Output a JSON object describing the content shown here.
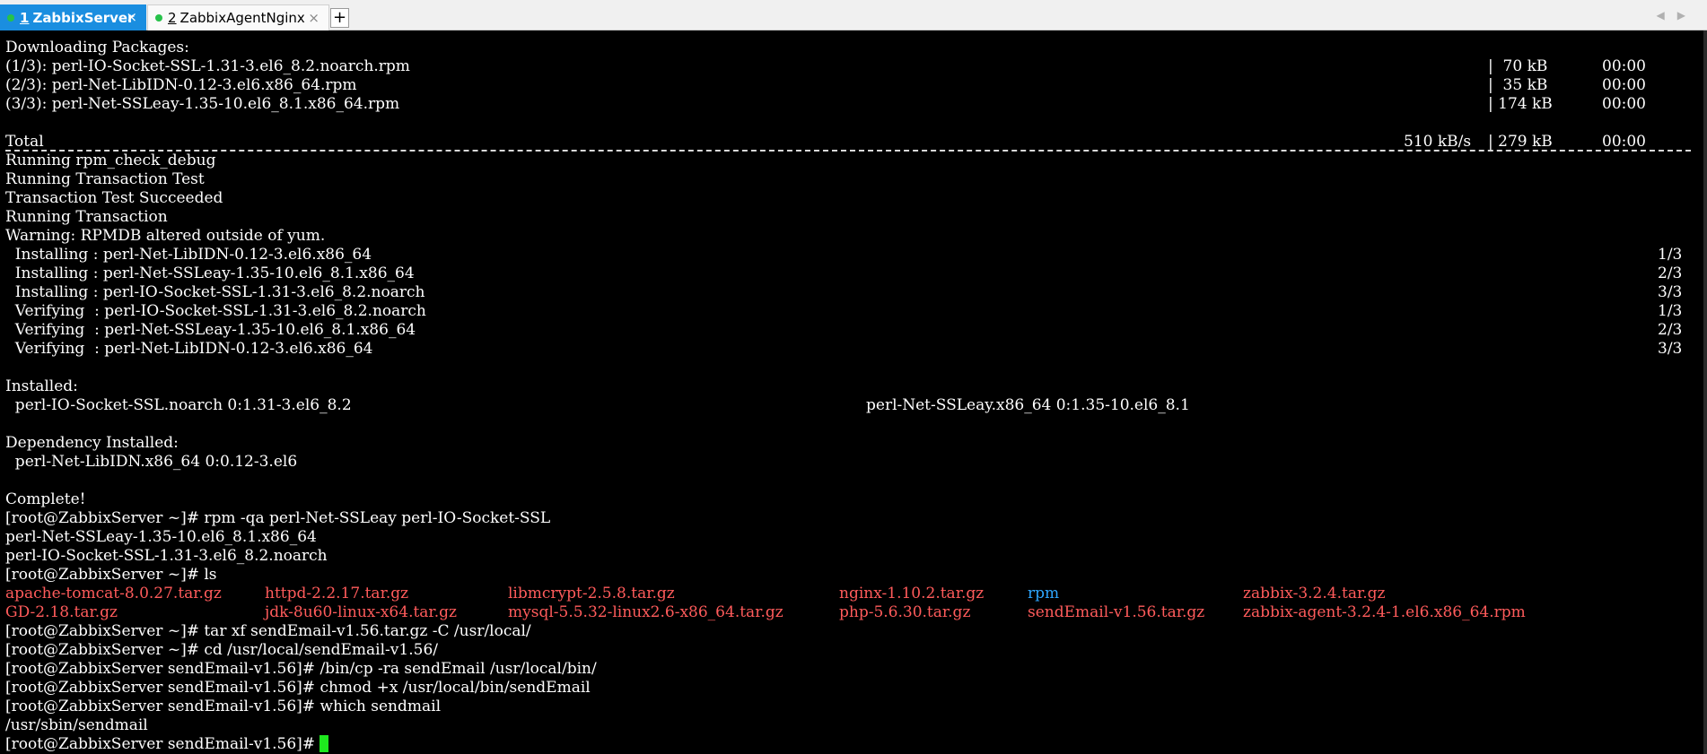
{
  "tabs": [
    {
      "number": "1",
      "title": "ZabbixServer",
      "close": "×"
    },
    {
      "number": "2",
      "title": "ZabbixAgentNginx",
      "close": "×"
    }
  ],
  "new_tab": "+",
  "nav": {
    "left": "◀",
    "right": "▶"
  },
  "terminal": {
    "downloading": "Downloading Packages:",
    "dl1": {
      "name": "(1/3): perl-IO-Socket-SSL-1.31-3.el6_8.2.noarch.rpm",
      "size": "|  70 kB",
      "time": "00:00"
    },
    "dl2": {
      "name": "(2/3): perl-Net-LibIDN-0.12-3.el6.x86_64.rpm",
      "size": "|  35 kB",
      "time": "00:00"
    },
    "dl3": {
      "name": "(3/3): perl-Net-SSLeay-1.35-10.el6_8.1.x86_64.rpm",
      "size": "| 174 kB",
      "time": "00:00"
    },
    "total": {
      "label": "Total",
      "rate": "510 kB/s",
      "size": "| 279 kB",
      "time": "00:00"
    },
    "l_check": "Running rpm_check_debug",
    "l_test": "Running Transaction Test",
    "l_succeeded": "Transaction Test Succeeded",
    "l_running": "Running Transaction",
    "l_warning": "Warning: RPMDB altered outside of yum.",
    "tx": [
      {
        "text": "  Installing : perl-Net-LibIDN-0.12-3.el6.x86_64",
        "count": "1/3"
      },
      {
        "text": "  Installing : perl-Net-SSLeay-1.35-10.el6_8.1.x86_64",
        "count": "2/3"
      },
      {
        "text": "  Installing : perl-IO-Socket-SSL-1.31-3.el6_8.2.noarch",
        "count": "3/3"
      },
      {
        "text": "  Verifying  : perl-IO-Socket-SSL-1.31-3.el6_8.2.noarch",
        "count": "1/3"
      },
      {
        "text": "  Verifying  : perl-Net-SSLeay-1.35-10.el6_8.1.x86_64",
        "count": "2/3"
      },
      {
        "text": "  Verifying  : perl-Net-LibIDN-0.12-3.el6.x86_64",
        "count": "3/3"
      }
    ],
    "installed_label": "Installed:",
    "installed_a": "  perl-IO-Socket-SSL.noarch 0:1.31-3.el6_8.2",
    "installed_b": "perl-Net-SSLeay.x86_64 0:1.35-10.el6_8.1",
    "dep_label": "Dependency Installed:",
    "dep_item": "  perl-Net-LibIDN.x86_64 0:0.12-3.el6",
    "complete": "Complete!",
    "cmd_rpm": "[root@ZabbixServer ~]# rpm -qa perl-Net-SSLeay perl-IO-Socket-SSL",
    "out_rpm1": "perl-Net-SSLeay-1.35-10.el6_8.1.x86_64",
    "out_rpm2": "perl-IO-Socket-SSL-1.31-3.el6_8.2.noarch",
    "cmd_ls": "[root@ZabbixServer ~]# ls",
    "ls_row1": [
      "apache-tomcat-8.0.27.tar.gz",
      "httpd-2.2.17.tar.gz",
      "libmcrypt-2.5.8.tar.gz",
      "nginx-1.10.2.tar.gz",
      "rpm",
      "zabbix-3.2.4.tar.gz"
    ],
    "ls_row2": [
      "GD-2.18.tar.gz",
      "jdk-8u60-linux-x64.tar.gz",
      "mysql-5.5.32-linux2.6-x86_64.tar.gz",
      "php-5.6.30.tar.gz",
      "sendEmail-v1.56.tar.gz",
      "zabbix-agent-3.2.4-1.el6.x86_64.rpm"
    ],
    "cmd_tar": "[root@ZabbixServer ~]# tar xf sendEmail-v1.56.tar.gz -C /usr/local/",
    "cmd_cd": "[root@ZabbixServer ~]# cd /usr/local/sendEmail-v1.56/",
    "cmd_cp": "[root@ZabbixServer sendEmail-v1.56]# /bin/cp -ra sendEmail /usr/local/bin/",
    "cmd_chmod": "[root@ZabbixServer sendEmail-v1.56]# chmod +x /usr/local/bin/sendEmail",
    "cmd_which": "[root@ZabbixServer sendEmail-v1.56]# which sendmail",
    "out_which": "/usr/sbin/sendmail",
    "prompt": "[root@ZabbixServer sendEmail-v1.56]# "
  },
  "colors": {
    "archive": "#ff5b5b",
    "directory": "#2ea6ff",
    "cursor": "#1ee81e",
    "tab_active": "#1a8ee0"
  }
}
